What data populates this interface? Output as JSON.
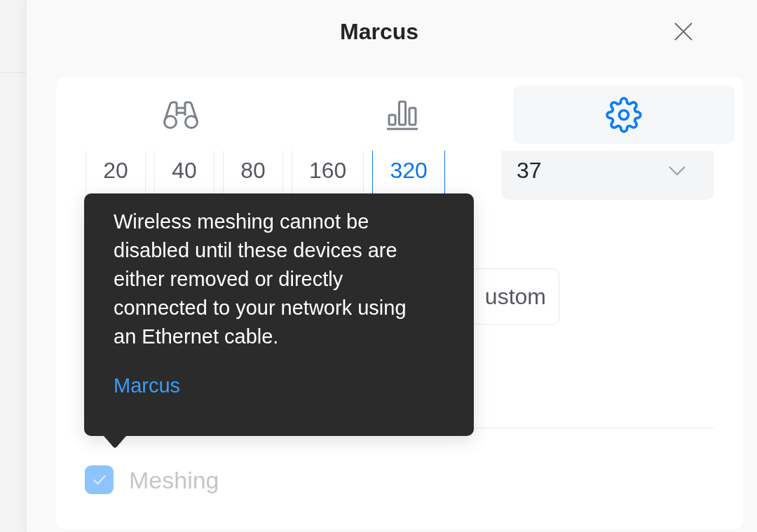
{
  "dialog": {
    "title": "Marcus"
  },
  "tabs": [
    {
      "selected": false
    },
    {
      "selected": false
    },
    {
      "selected": true
    }
  ],
  "channel_widths": [
    {
      "label": "20",
      "selected": false
    },
    {
      "label": "40",
      "selected": false
    },
    {
      "label": "80",
      "selected": false
    },
    {
      "label": "160",
      "selected": false
    },
    {
      "label": "320",
      "selected": true
    }
  ],
  "channel_select": {
    "value": "37"
  },
  "mode_button": {
    "label": "ustom"
  },
  "tooltip": {
    "text": "Wireless meshing cannot be disabled until these devices are either removed or directly connected to your network using an Ethernet cable.",
    "link": "Marcus"
  },
  "meshing": {
    "label": "Meshing",
    "checked": true,
    "disabled": true
  }
}
